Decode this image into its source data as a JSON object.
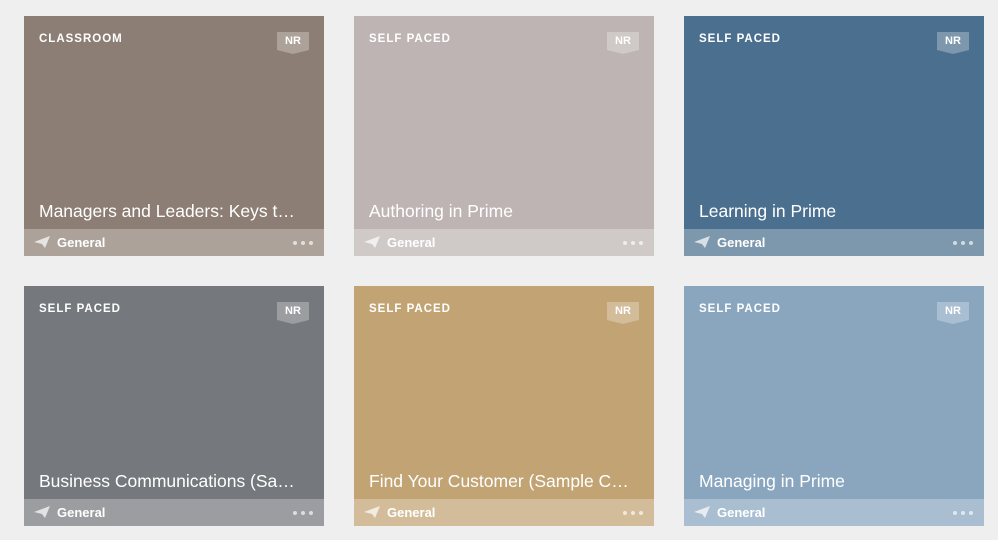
{
  "cards": [
    {
      "type": "CLASSROOM",
      "badge": "NR",
      "title": "Managers and Leaders: Keys to S...",
      "catalog": "General",
      "color": "#8c7e74"
    },
    {
      "type": "SELF PACED",
      "badge": "NR",
      "title": "Authoring in Prime",
      "catalog": "General",
      "color": "#bdb4b3"
    },
    {
      "type": "SELF PACED",
      "badge": "NR",
      "title": "Learning in Prime",
      "catalog": "General",
      "color": "#4b6f8e"
    },
    {
      "type": "SELF PACED",
      "badge": "NR",
      "title": "Business Communications (Sam...",
      "catalog": "General",
      "color": "#75787c"
    },
    {
      "type": "SELF PACED",
      "badge": "NR",
      "title": "Find Your Customer (Sample Cou...",
      "catalog": "General",
      "color": "#c2a373"
    },
    {
      "type": "SELF PACED",
      "badge": "NR",
      "title": "Managing in Prime",
      "catalog": "General",
      "color": "#8aa6bf"
    }
  ]
}
